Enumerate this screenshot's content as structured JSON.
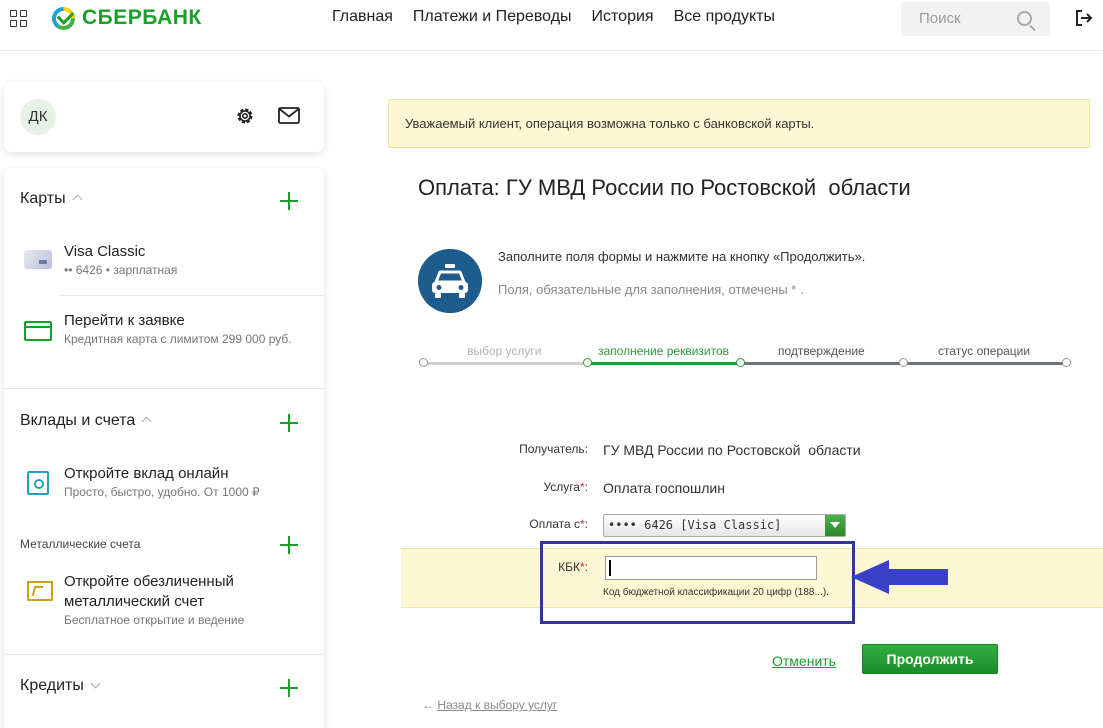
{
  "header": {
    "logo_text": "СБЕРБАНК",
    "nav": [
      "Главная",
      "Платежи и Переводы",
      "История",
      "Все продукты"
    ],
    "search_placeholder": "Поиск"
  },
  "profile": {
    "initials": "ДК"
  },
  "sidebar": {
    "cards": {
      "title": "Карты",
      "items": [
        {
          "title": "Visa Classic",
          "subtitle": "•• 6426 • зарплатная"
        },
        {
          "title": "Перейти к заявке",
          "subtitle": "Кредитная карта с лимитом 299 000 руб."
        }
      ]
    },
    "deposits": {
      "title": "Вклады и счета",
      "item": {
        "title": "Откройте вклад онлайн",
        "subtitle": "Просто, быстро, удобно. От 1000 ₽"
      }
    },
    "metals": {
      "title": "Металлические счета",
      "item": {
        "title_line1": "Откройте обезличенный",
        "title_line2": "металлический счет",
        "subtitle": "Бесплатное открытие и ведение"
      }
    },
    "credits": {
      "title": "Кредиты"
    }
  },
  "main": {
    "notice": "Уважаемый клиент, операция возможна только с банковской карты.",
    "title": "Оплата: ГУ МВД России по Ростовской  области",
    "info_line1": "Заполните поля формы и нажмите на кнопку «Продолжить».",
    "info_line2": "Поля, обязательные для заполнения, отмечены * .",
    "steps": [
      "выбор услуги",
      "заполнение реквизитов",
      "подтверждение",
      "статус операции"
    ],
    "form": {
      "recipient_label": "Получатель:",
      "recipient_value": "ГУ МВД России по Ростовской  области",
      "service_label": "Услуга",
      "service_value": "Оплата госпошлин",
      "payment_label": "Оплата с",
      "payment_value": "•••• 6426  [Visa Classic]",
      "kbk_label": "КБК",
      "kbk_value": "",
      "kbk_hint": "Код бюджетной классификации 20 цифр (188...).",
      "req_mark": "*",
      "colon": ":"
    },
    "cancel": "Отменить",
    "continue": "Продолжить",
    "back": "Назад к выбору услуг",
    "back_arrow": "←"
  },
  "colors": {
    "brand_green": "#1a9f29",
    "notice_bg": "#fdf8d3",
    "annotation_blue": "#343592",
    "police_icon_bg": "#1d5c8c"
  }
}
